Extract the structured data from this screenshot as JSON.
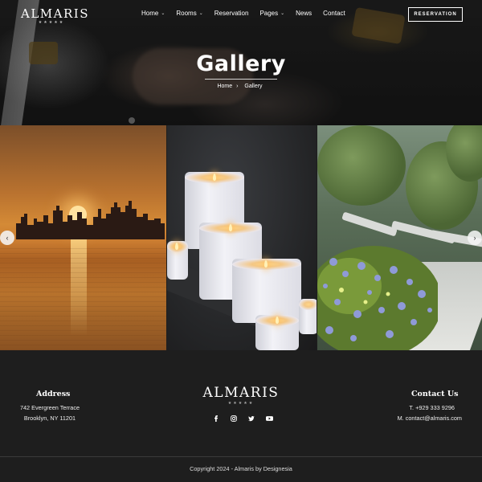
{
  "brand": {
    "name": "ALMARIS",
    "stars": "★★★★★"
  },
  "nav": {
    "items": [
      {
        "label": "Home",
        "has_dropdown": true
      },
      {
        "label": "Rooms",
        "has_dropdown": true
      },
      {
        "label": "Reservation",
        "has_dropdown": false
      },
      {
        "label": "Pages",
        "has_dropdown": true
      },
      {
        "label": "News",
        "has_dropdown": false
      },
      {
        "label": "Contact",
        "has_dropdown": false
      }
    ],
    "cta_label": "RESERVATION"
  },
  "hero": {
    "title": "Gallery",
    "breadcrumb": {
      "home": "Home",
      "separator": "›",
      "current": "Gallery"
    }
  },
  "gallery": {
    "images": [
      {
        "subject": "city-skyline-sunset"
      },
      {
        "subject": "lit-white-candles"
      },
      {
        "subject": "poolside-garden-loungers"
      }
    ],
    "prev_icon": "chevron-left-icon",
    "next_icon": "chevron-right-icon"
  },
  "footer": {
    "address": {
      "title": "Address",
      "line1": "742 Evergreen Terrace",
      "line2": "Brooklyn, NY 11201"
    },
    "logo": {
      "name": "ALMARIS",
      "stars": "★★★★★"
    },
    "socials": [
      {
        "icon": "facebook-icon"
      },
      {
        "icon": "instagram-icon"
      },
      {
        "icon": "twitter-icon"
      },
      {
        "icon": "youtube-icon"
      }
    ],
    "contact": {
      "title": "Contact Us",
      "phone": "T. +929 333 9296",
      "email": "M. contact@almaris.com"
    },
    "copyright": "Copyright 2024 - Almaris by Designesia"
  },
  "colors": {
    "background": "#1e1e1e",
    "text": "#ffffff"
  }
}
